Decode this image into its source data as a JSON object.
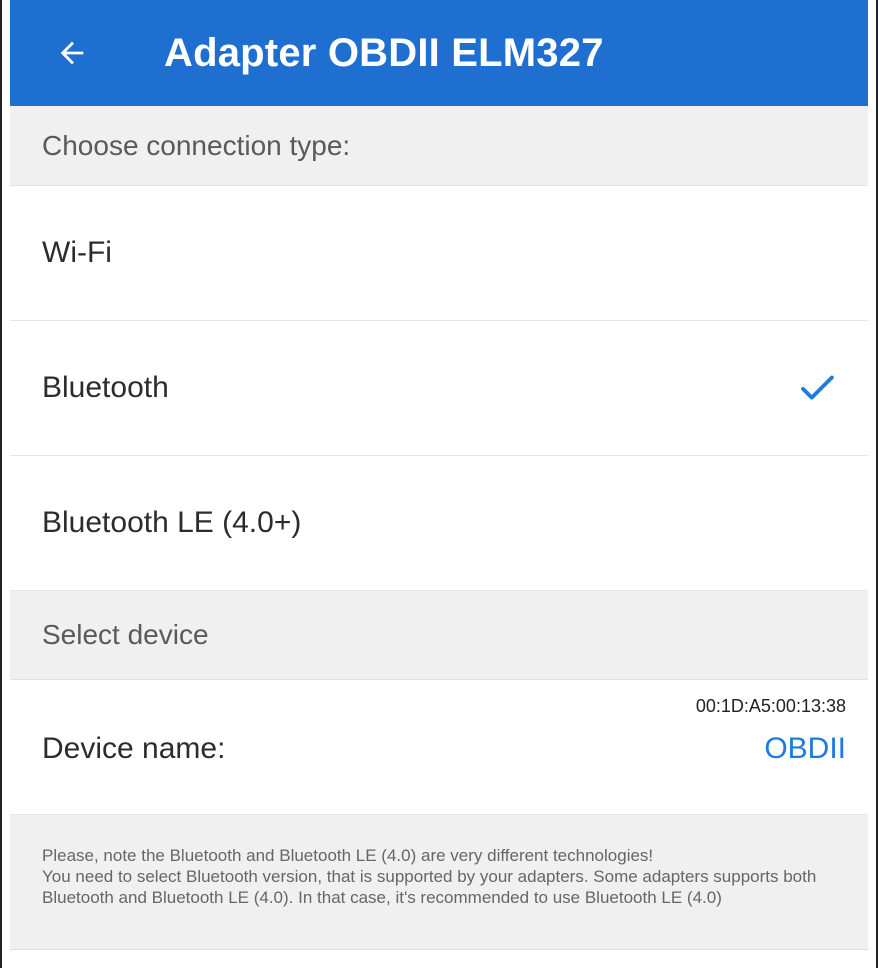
{
  "app_bar": {
    "title": "Adapter OBDII ELM327",
    "back_icon": "arrow-left-icon",
    "color": "#1f6fd1"
  },
  "connection": {
    "header": "Choose connection type:",
    "options": [
      {
        "label": "Wi-Fi",
        "selected": false
      },
      {
        "label": "Bluetooth",
        "selected": true
      },
      {
        "label": "Bluetooth LE (4.0+)",
        "selected": false
      }
    ],
    "check_icon": "checkmark-icon",
    "check_color": "#1f7ae0"
  },
  "device": {
    "header": "Select device",
    "label": "Device name:",
    "mac": "00:1D:A5:00:13:38",
    "name": "OBDII",
    "name_color": "#1f7ae0"
  },
  "note": {
    "lines": [
      "Please, note the Bluetooth and Bluetooth LE (4.0) are very different technologies!",
      "You need to select Bluetooth version, that is supported by your adapters. Some adapters supports both Bluetooth and Bluetooth LE (4.0). In that case, it's recommended to use Bluetooth LE (4.0)"
    ]
  }
}
